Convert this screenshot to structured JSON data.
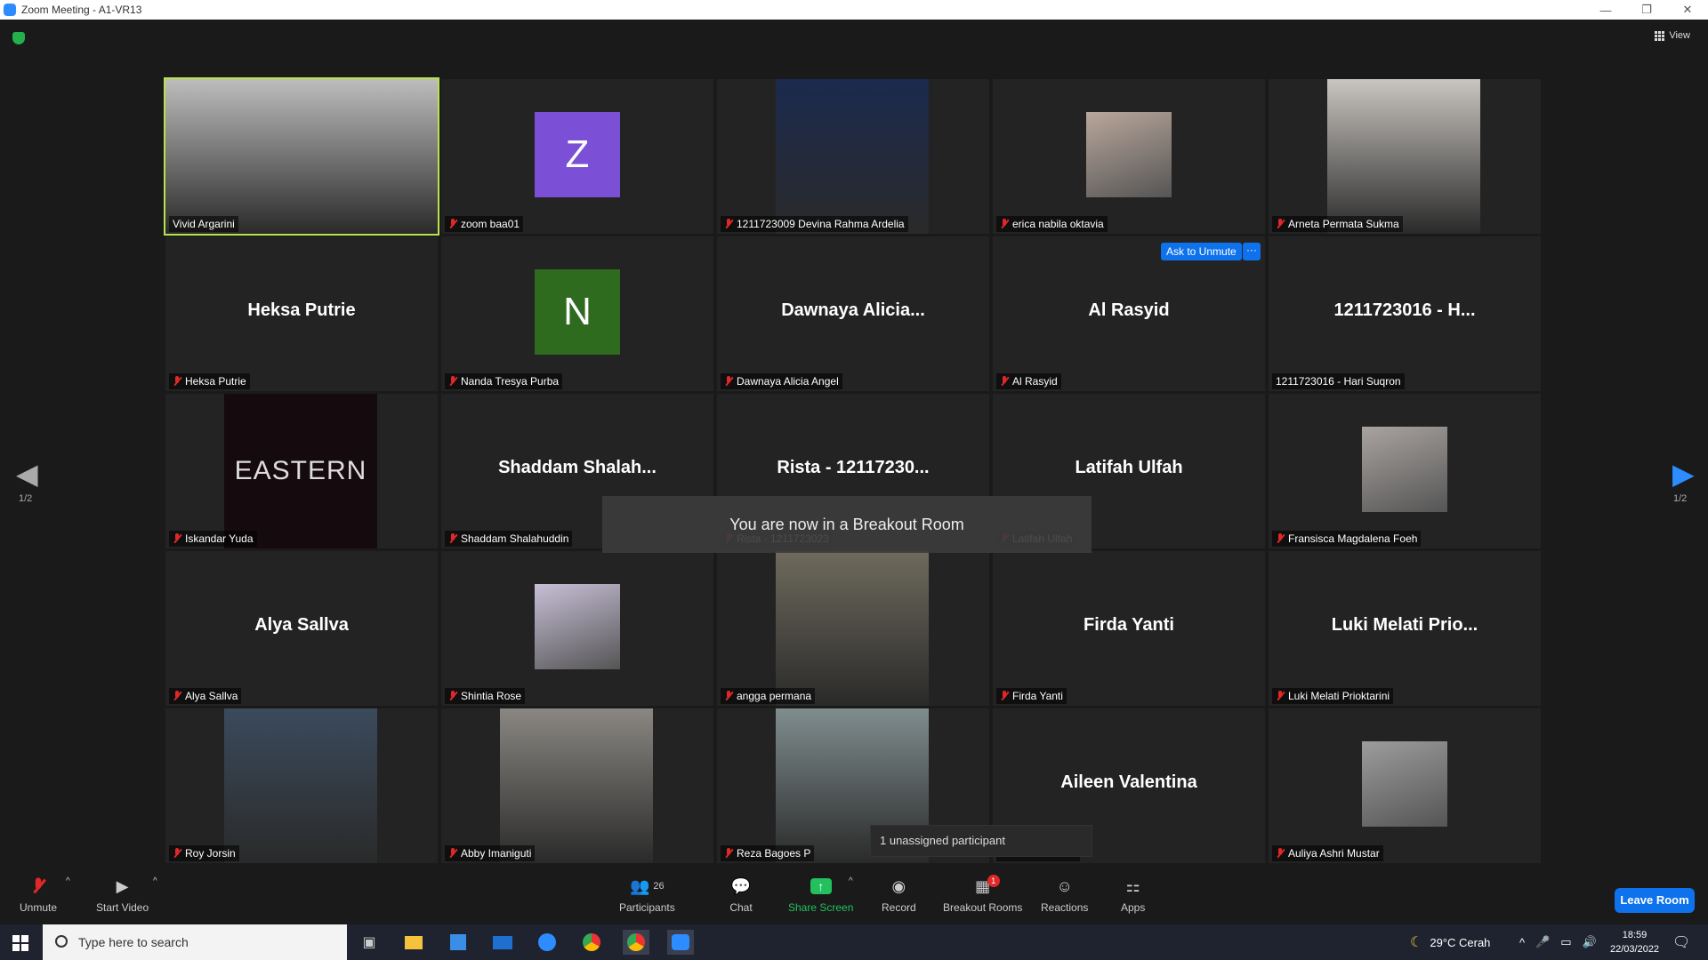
{
  "window": {
    "title": "Zoom Meeting - A1-VR13",
    "controls": [
      "—",
      "❐",
      "✕"
    ]
  },
  "view": {
    "label": "View"
  },
  "pager": {
    "left": "1/2",
    "right": "1/2"
  },
  "tiles": [
    {
      "name": "Vivid Argarini",
      "big": "",
      "type": "photo",
      "active": true,
      "muted": false,
      "color": "#bdbdbd"
    },
    {
      "name": "zoom baa01",
      "big": "Z",
      "type": "avatar",
      "muted": true,
      "color": "#7b4fd6"
    },
    {
      "name": "1211723009 Devina Rahma Ardelia",
      "big": "",
      "type": "photo",
      "muted": true,
      "color": "#1b2a4e"
    },
    {
      "name": "erica nabila oktavia",
      "big": "",
      "type": "thumb",
      "muted": true,
      "color": "#b9a79b"
    },
    {
      "name": "Arneta Permata Sukma",
      "big": "",
      "type": "photo",
      "muted": true,
      "color": "#c9c5c0"
    },
    {
      "name": "Heksa Putrie",
      "big": "Heksa Putrie",
      "type": "text",
      "muted": true
    },
    {
      "name": "Nanda Tresya Purba",
      "big": "N",
      "type": "avatar",
      "muted": true,
      "color": "#2f6b1f"
    },
    {
      "name": "Dawnaya Alicia Angel",
      "big": "Dawnaya  Alicia...",
      "type": "text",
      "muted": true
    },
    {
      "name": "Al Rasyid",
      "big": "Al Rasyid",
      "type": "text",
      "muted": true
    },
    {
      "name": "1211723016 - Hari Suqron",
      "big": "1211723016 - H...",
      "type": "text",
      "muted": false
    },
    {
      "name": "Iskandar Yuda",
      "big": "EASTERN",
      "type": "logo",
      "muted": true,
      "color": "#150a0d"
    },
    {
      "name": "Shaddam Shalahuddin",
      "big": "Shaddam  Shalah...",
      "type": "text",
      "muted": true
    },
    {
      "name": "Rista - 1211723023",
      "big": "Rista - 12117230...",
      "type": "text",
      "muted": true
    },
    {
      "name": "Latifah Ulfah",
      "big": "Latifah Ulfah",
      "type": "text",
      "muted": true
    },
    {
      "name": "Fransisca Magdalena Foeh",
      "big": "",
      "type": "thumb",
      "muted": true,
      "color": "#a9a3a0"
    },
    {
      "name": "Alya Sallva",
      "big": "Alya Sallva",
      "type": "text",
      "muted": true
    },
    {
      "name": "Shintia Rose",
      "big": "",
      "type": "thumb",
      "muted": true,
      "color": "#c7bfd6"
    },
    {
      "name": "angga permana",
      "big": "",
      "type": "photo",
      "muted": true,
      "color": "#6e6a5c"
    },
    {
      "name": "Firda Yanti",
      "big": "Firda Yanti",
      "type": "text",
      "muted": true
    },
    {
      "name": "Luki Melati Prioktarini",
      "big": "Luki Melati Prio...",
      "type": "text",
      "muted": true
    },
    {
      "name": "Roy Jorsin",
      "big": "",
      "type": "photo",
      "muted": true,
      "color": "#3b4a5c"
    },
    {
      "name": "Abby Imaniguti",
      "big": "",
      "type": "photo",
      "muted": true,
      "color": "#8a8782"
    },
    {
      "name": "Reza Bagoes P",
      "big": "",
      "type": "photo",
      "muted": true,
      "color": "#7f8d8e"
    },
    {
      "name": "Aileen Valentina",
      "big": "Aileen Valentina",
      "type": "text",
      "muted": false
    },
    {
      "name": "Auliya Ashri Mustar",
      "big": "",
      "type": "thumb",
      "muted": true,
      "color": "#9c9c9c"
    }
  ],
  "overlays": {
    "breakout_toast": "You are now in a Breakout Room",
    "ask_to_unmute": "Ask to Unmute",
    "more": "···",
    "unassigned": "1 unassigned participant"
  },
  "toolbar": {
    "unmute": "Unmute",
    "start_video": "Start Video",
    "participants": "Participants",
    "participants_count": "26",
    "chat": "Chat",
    "share_screen": "Share Screen",
    "record": "Record",
    "breakout_rooms": "Breakout Rooms",
    "breakout_badge": "1",
    "reactions": "Reactions",
    "apps": "Apps",
    "leave": "Leave Room"
  },
  "taskbar": {
    "search_placeholder": "Type here to search",
    "weather": "29°C  Cerah",
    "time": "18:59",
    "date": "22/03/2022"
  }
}
